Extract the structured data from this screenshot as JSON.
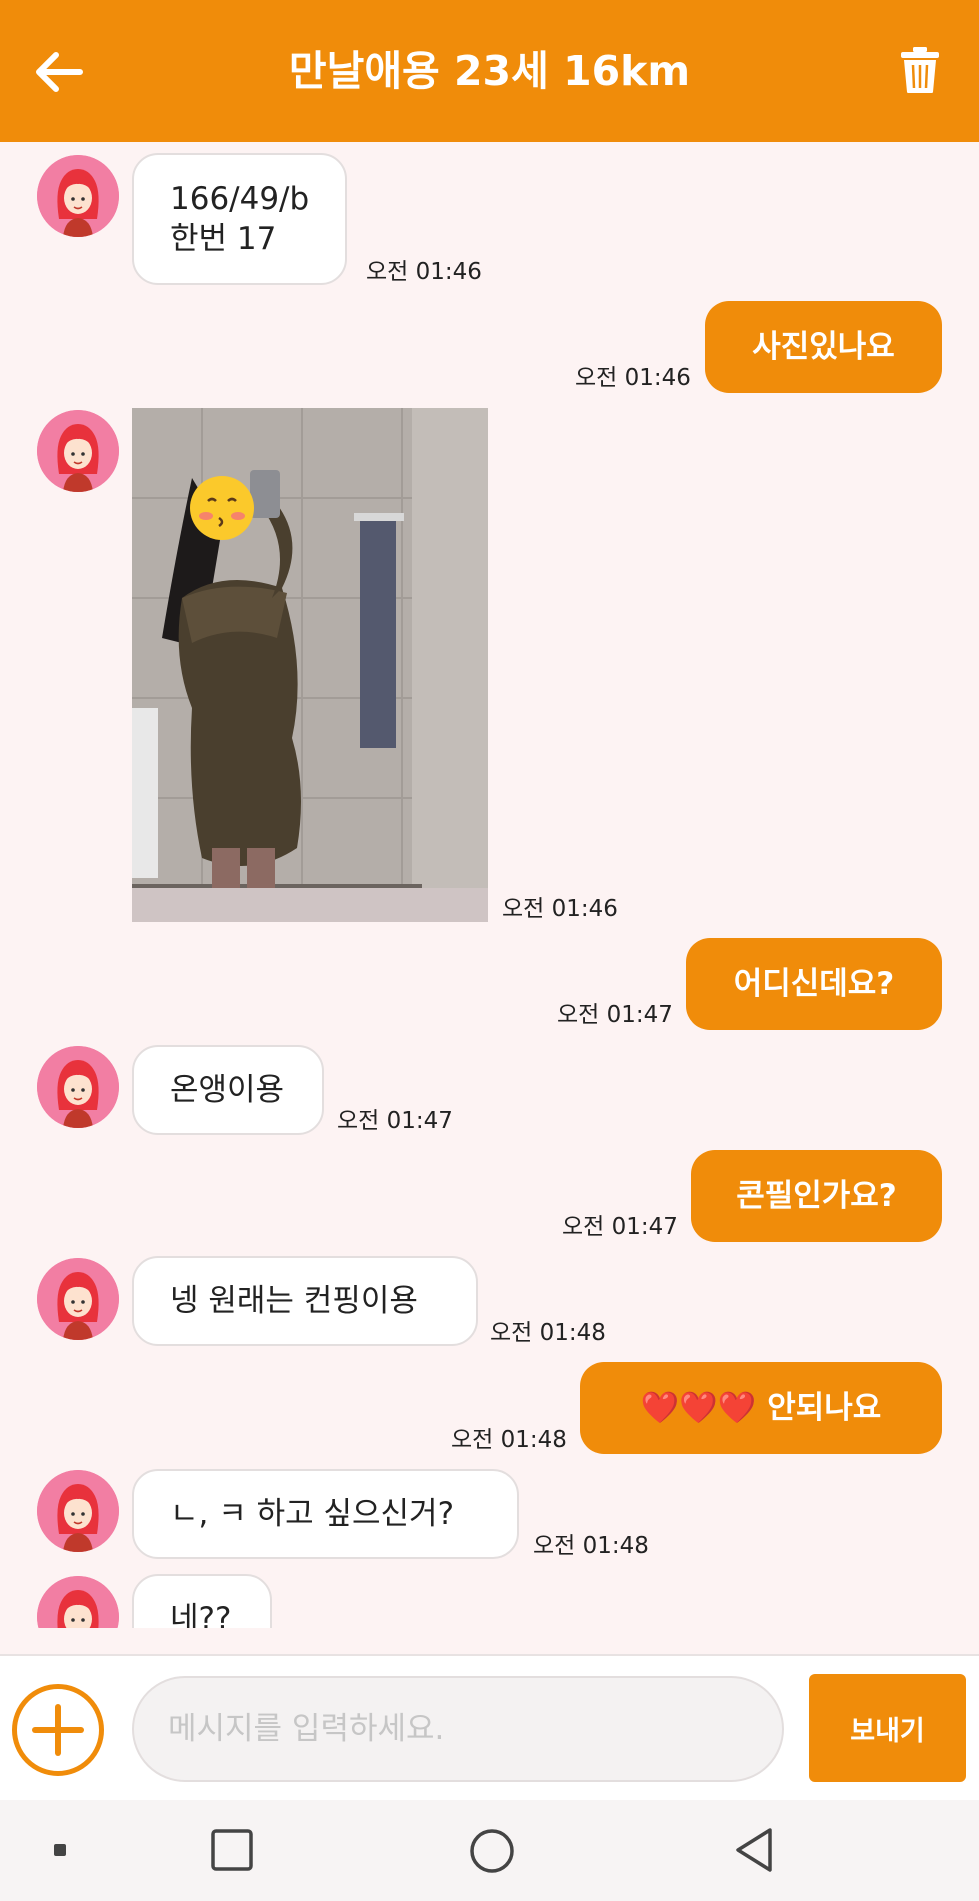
{
  "header": {
    "title": "만날애용 23세 16km",
    "back_icon": "arrow-left-icon",
    "delete_icon": "trash-icon",
    "background": "#f08c0a"
  },
  "messages": [
    {
      "side": "in",
      "lines": [
        "166/49/b",
        "한번 17"
      ],
      "time": "오전 01:46"
    },
    {
      "side": "out",
      "text": "사진있나요",
      "time": "오전 01:46"
    },
    {
      "side": "in",
      "type": "photo",
      "alt": "image",
      "time": "오전 01:46"
    },
    {
      "side": "out",
      "text": "어디신데요?",
      "time": "오전 01:47"
    },
    {
      "side": "in",
      "text": "온앵이용",
      "time": "오전 01:47"
    },
    {
      "side": "out",
      "text": "콘필인가요?",
      "time": "오전 01:47"
    },
    {
      "side": "in",
      "text": "넹 원래는 컨핑이용",
      "time": "오전 01:48"
    },
    {
      "side": "out",
      "text": "❤️❤️❤️ 안되나요",
      "time": "오전 01:48"
    },
    {
      "side": "in",
      "text": "ㄴ, ㅋ 하고 싶으신거?",
      "time": "오전 01:48"
    },
    {
      "side": "in",
      "text": "네??",
      "time": ""
    }
  ],
  "composer": {
    "add_icon": "plus-circle-icon",
    "placeholder": "메시지를 입력하세요.",
    "value": "",
    "send_label": "보내기"
  },
  "system_nav": {
    "icons": [
      "recents-dot-icon",
      "square-icon",
      "circle-home-icon",
      "triangle-back-icon"
    ]
  },
  "colors": {
    "accent": "#f08c0a",
    "chat_background": "#fdf3f3",
    "incoming_bubble": "#ffffff",
    "avatar": "#f27ea3"
  }
}
